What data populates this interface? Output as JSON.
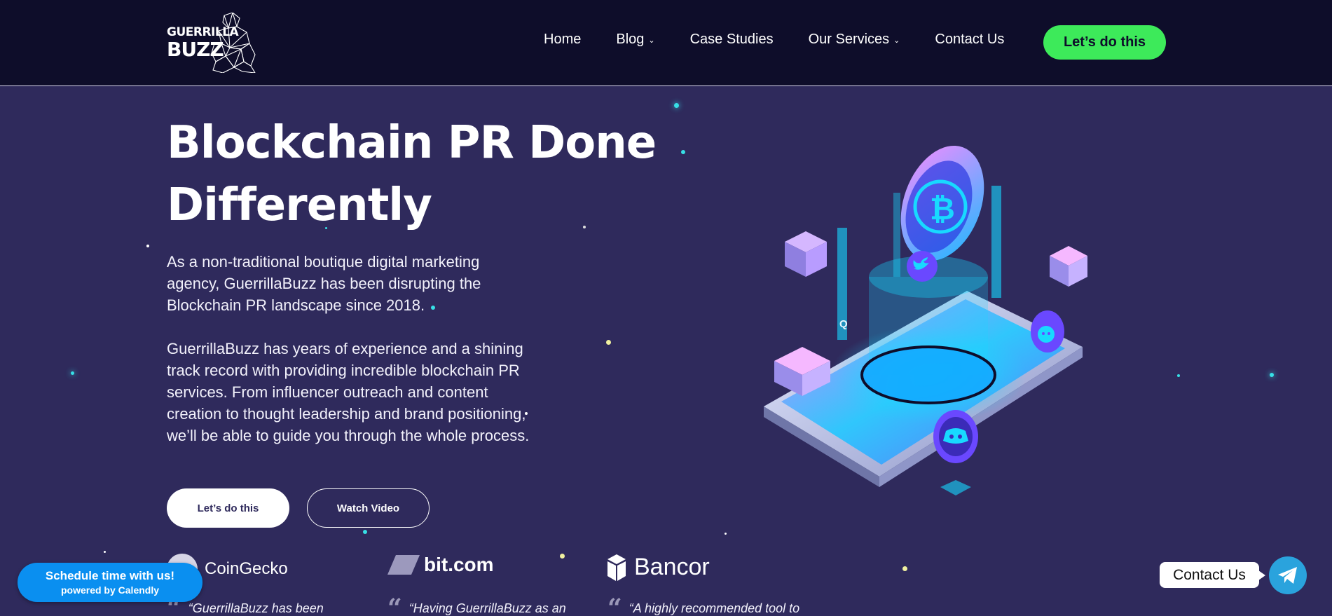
{
  "nav": {
    "logo_line1": "GUERRILLA",
    "logo_line2": "BUZZ",
    "items": [
      {
        "label": "Home",
        "dropdown": false
      },
      {
        "label": "Blog",
        "dropdown": true
      },
      {
        "label": "Case Studies",
        "dropdown": false
      },
      {
        "label": "Our Services",
        "dropdown": true
      },
      {
        "label": "Contact Us",
        "dropdown": false
      }
    ],
    "cta": "Let’s do this"
  },
  "hero": {
    "title_line1": "Blockchain PR Done",
    "title_line2": "Differently",
    "paragraph1": "As a non-traditional boutique digital marketing agency, GuerrillaBuzz has been disrupting the Blockchain PR landscape since 2018.",
    "paragraph2": "GuerrillaBuzz has years of experience and a shining track record with providing incredible blockchain PR services. From influencer outreach and content creation to thought leadership and brand positioning, we’ll be able to guide you through the whole process.",
    "primary_button": "Let’s do this",
    "secondary_button": "Watch Video"
  },
  "illustration": {
    "icons": [
      "bitcoin-icon",
      "twitter-icon",
      "reddit-icon",
      "discord-icon"
    ],
    "q_label": "Q"
  },
  "testimonials": [
    {
      "brand": "CoinGecko",
      "quote": "“GuerrillaBuzz has been"
    },
    {
      "brand": "bit.com",
      "quote": "“Having GuerrillaBuzz as an"
    },
    {
      "brand": "Bancor",
      "quote": "“A highly recommended tool to"
    }
  ],
  "calendly": {
    "title": "Schedule time with us!",
    "subtitle": "powered by Calendly"
  },
  "contact": {
    "label": "Contact Us"
  },
  "colors": {
    "background": "#2f2a5c",
    "nav_background": "#0e0d2a",
    "cta_green": "#3dea5a",
    "calendly_blue": "#0a8ff0",
    "telegram_blue": "#2aa3dd"
  }
}
